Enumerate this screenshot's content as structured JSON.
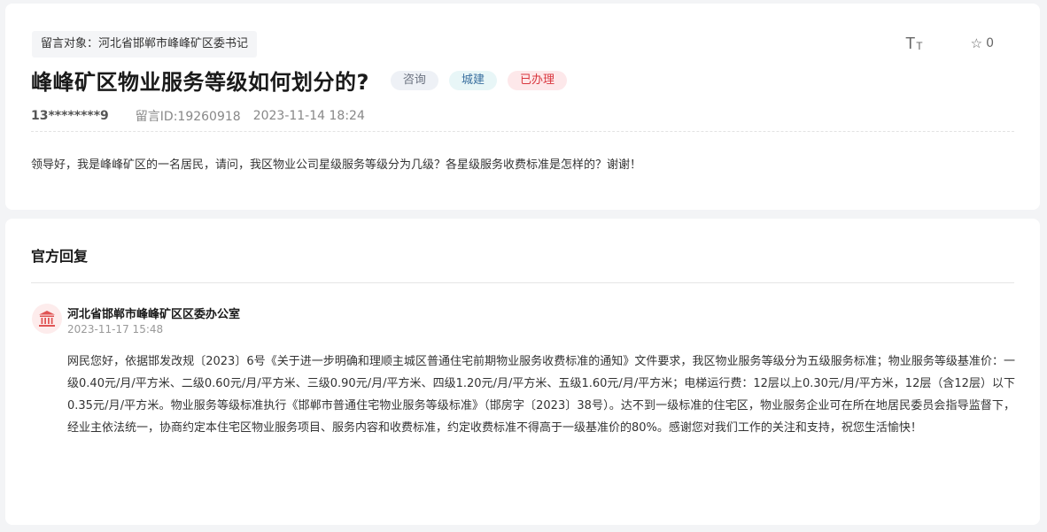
{
  "message": {
    "recipient": "留言对象：河北省邯郸市峰峰矿区委书记",
    "title": "峰峰矿区物业服务等级如何划分的?",
    "tags": [
      "咨询",
      "城建",
      "已办理"
    ],
    "user": "13********9",
    "message_id": "留言ID:19260918",
    "datetime": "2023-11-14 18:24",
    "content": "领导好，我是峰峰矿区的一名居民，请问，我区物业公司星级服务等级分为几级？各星级服务收费标准是怎样的？谢谢！",
    "star_count": "0",
    "font_size_icon": "text-size-icon",
    "star_icon": "star-outline-icon"
  },
  "reply": {
    "section_title": "官方回复",
    "department": "河北省邯郸市峰峰矿区区委办公室",
    "datetime": "2023-11-17 15:48",
    "department_icon": "government-building-icon",
    "text": "网民您好，依据邯发改规〔2023〕6号《关于进一步明确和理顺主城区普通住宅前期物业服务收费标准的通知》文件要求，我区物业服务等级分为五级服务标准；物业服务等级基准价：一级0.40元/月/平方米、二级0.60元/月/平方米、三级0.90元/月/平方米、四级1.20元/月/平方米、五级1.60元/月/平方米；电梯运行费：12层以上0.30元/月/平方米，12层（含12层）以下0.35元/月/平方米。物业服务等级标准执行《邯郸市普通住宅物业服务等级标准》（邯房字〔2023〕38号）。达不到一级标准的住宅区，物业服务企业可在所在地居民委员会指导监督下，经业主依法统一，协商约定本住宅区物业服务项目、服务内容和收费标准，约定收费标准不得高于一级基准价的80%。感谢您对我们工作的关注和支持，祝您生活愉快！"
  },
  "colors": {
    "background": "#f3f4f6",
    "badge_consult_bg": "#eef1f6",
    "badge_urban_bg": "#e8f6f7",
    "badge_done_bg": "#fde8ea",
    "badge_done_text": "#d9363e",
    "department_icon": "#e05555"
  }
}
